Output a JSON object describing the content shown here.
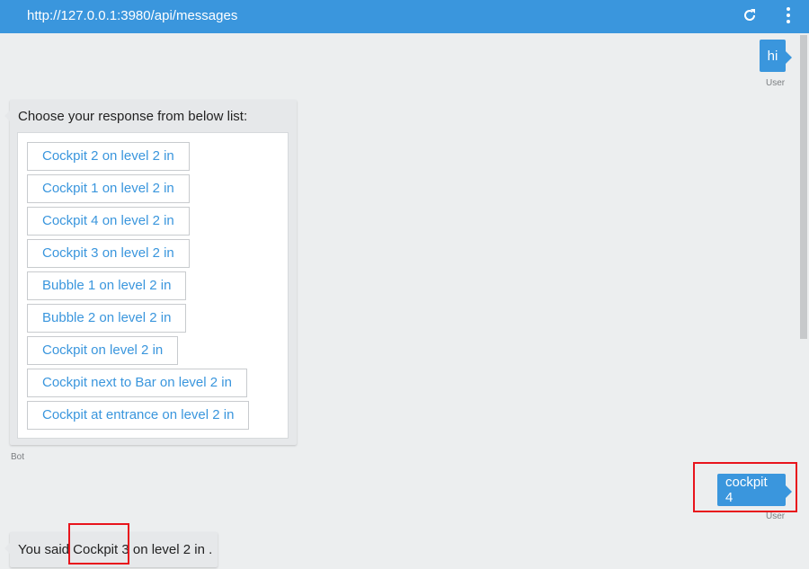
{
  "header": {
    "url": "http://127.0.0.1:3980/api/messages",
    "refresh_icon": "refresh-icon",
    "menu_icon": "more-vertical-icon",
    "accent_color": "#3a96dd"
  },
  "messages": [
    {
      "from": "User",
      "text": "hi"
    },
    {
      "from": "Bot",
      "prompt": "Choose your response from below list:",
      "choices": [
        "Cockpit 2 on level 2 in",
        "Cockpit 1 on level 2 in",
        "Cockpit 4 on level 2 in",
        "Cockpit 3 on level 2 in",
        "Bubble 1 on level 2 in",
        "Bubble 2 on level 2 in",
        "Cockpit on level 2 in",
        "Cockpit next to Bar on level 2 in",
        "Cockpit at entrance on level 2 in"
      ]
    },
    {
      "from": "User",
      "text": "cockpit 4"
    },
    {
      "from": "Bot",
      "text": "You said Cockpit 3 on level 2 in ."
    }
  ]
}
